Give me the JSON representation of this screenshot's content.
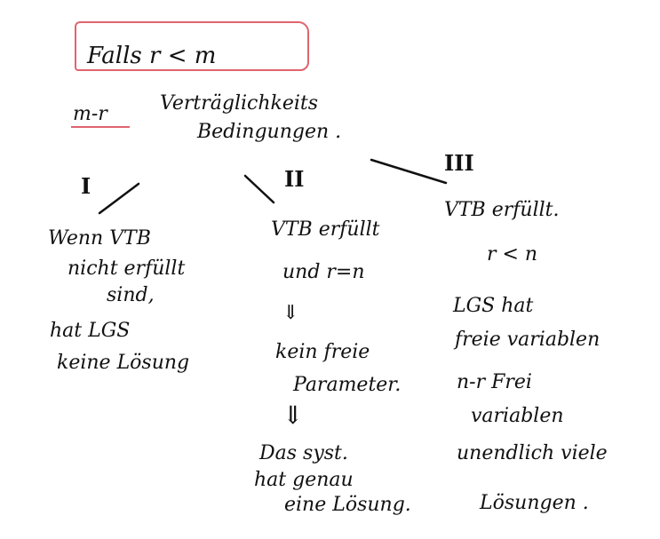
{
  "board": {
    "title": "Falls r < m",
    "defect": "m-r",
    "condition_line1": "Verträglichkeits",
    "condition_line2": "Bedingungen .",
    "cases": [
      {
        "number": "I",
        "lines": [
          "Wenn VTB",
          "nicht erfüllt",
          "sind,",
          "hat LGS",
          "keine Lösung"
        ]
      },
      {
        "number": "II",
        "lines": [
          "VTB erfüllt",
          "und r=n",
          "⇓",
          "kein freie",
          "Parameter.",
          "⇓",
          "Das syst.",
          "hat genau",
          "eine Lösung."
        ]
      },
      {
        "number": "III",
        "lines": [
          "VTB erfüllt.",
          "r < n",
          "LGS hat",
          "freie variablen",
          "n-r Frei",
          "variablen",
          "unendlich viele",
          "Lösungen ."
        ]
      }
    ]
  },
  "colors": {
    "ink": "#111111",
    "highlight": "#e06470",
    "background": "#ffffff"
  }
}
